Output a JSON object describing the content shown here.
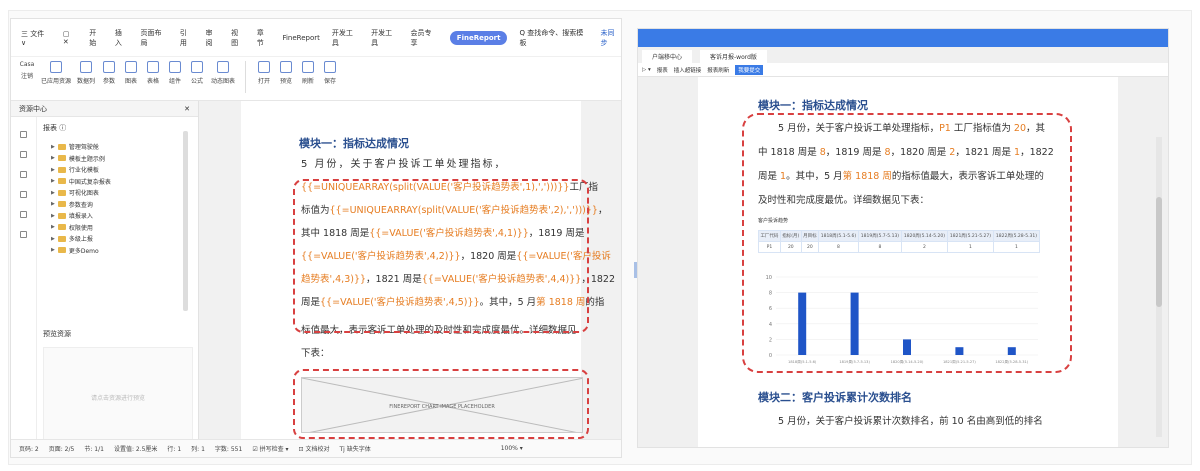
{
  "left": {
    "menu": [
      "三 文件 ∨",
      "▢ ✕",
      "开始",
      "插入",
      "页面布局",
      "引用",
      "审阅",
      "视图",
      "章节",
      "FineReport",
      "开发工具",
      "开发工具",
      "会员专享"
    ],
    "menu_pill": "FineReport",
    "menu_search": "Q 查找命令、搜索模板",
    "menu_right": "未同步",
    "ribbon": [
      "Casa",
      "注销",
      "已应用资源",
      "数据列",
      "参数",
      "图表",
      "表格",
      "组件",
      "公式",
      "动态图表",
      "打开",
      "预览",
      "刷新",
      "保存"
    ],
    "side_title": "资源中心",
    "side_close": "✕",
    "tree_header": "报表 ⓘ",
    "tree_items": [
      "管理驾驶舱",
      "模板主题示例",
      "行业化模板",
      "中国式复杂报表",
      "可视化图表",
      "参数查询",
      "填报录入",
      "权限使用",
      "多级上报",
      "更多Demo"
    ],
    "preview_title": "预览资源",
    "preview_placeholder": "请点击资源进行预览",
    "doc": {
      "heading": "模块一：指标达成情况",
      "p1": "5 月份，关于客户投诉工单处理指标，",
      "p2a": "{{=UNIQUEARRAY(split(VALUE('客户投诉趋势表',1),',')))}}",
      "p2b": "工厂指",
      "p3a": "标值为",
      "p3b": "{{=UNIQUEARRAY(split(VALUE('客户投诉趋势表',2),',')))}}",
      "p3c": "，",
      "p4a": "其中 1818 周是",
      "p4b": "{{=VALUE('客户投诉趋势表',4,1)}}",
      "p4c": "，1819 周是",
      "p5a": "{{=VALUE('客户投诉趋势表',4,2)}}",
      "p5b": "，1820 周是",
      "p5c": "{{=VALUE('客户投诉",
      "p6a": "趋势表',4,3)}}",
      "p6b": "，1821 周是",
      "p6c": "{{=VALUE('客户投诉趋势表',4,4)}}",
      "p6d": "，1822",
      "p7a": "周是",
      "p7b": "{{=VALUE('客户投诉趋势表',4,5)}}",
      "p7c": "。其中，5 月",
      "p7d": "第 1818 周",
      "p7e": "的指",
      "p8": "标值最大，表示客诉工单处理的及时性和完成度最优。详细数据见",
      "p9": "下表：",
      "img_caption": "FINEREPORT CHART IMAGE PLACEHOLDER"
    },
    "status": [
      "页码: 2",
      "页面: 2/5",
      "节: 1/1",
      "设置值: 2.5厘米",
      "行: 1",
      "列: 1",
      "字数: 551",
      "☑ 拼写检查 ▾",
      "⊡ 文档校对",
      "Tj 缺失字体",
      "100% ▾"
    ]
  },
  "right": {
    "tabs": [
      "户端移中心",
      "客诉月报-word版"
    ],
    "toolbar": [
      "▷ ▾",
      "报表",
      "插入超链接",
      "报表刷新",
      "我要提交"
    ],
    "heading": "模块一：指标达成情况",
    "l1a": "5 月份，关于客户投诉工单处理指标，",
    "l1b": "P1",
    "l1c": " 工厂指标值为 ",
    "l1d": "20",
    "l1e": "，其",
    "l2a": "中 1818 周是 ",
    "l2b": "8",
    "l2c": "，1819 周是 ",
    "l2d": "8",
    "l2e": "，1820 周是 ",
    "l2f": "2",
    "l2g": "，1821 周是 ",
    "l2h": "1",
    "l2i": "，1822",
    "l3a": "周是 ",
    "l3b": "1",
    "l3c": "。其中，5 月",
    "l3d": "第 1818 周",
    "l3e": "的指标值最大，表示客诉工单处理的",
    "l4": "及时性和完成度最优。详细数据见下表：",
    "report_title": "客户投诉趋势",
    "table_header": [
      "工厂代码",
      "指标(月)",
      "月目标",
      "1818周(5.1-5.6)",
      "1819周(5.7-5.13)",
      "1820周(5.14-5.20)",
      "1821周(5.21-5.27)",
      "1822周(5.28-5.31)"
    ],
    "table_row": [
      "P1",
      "20",
      "20",
      "8",
      "8",
      "2",
      "1",
      "1"
    ],
    "heading2": "模块二：客户投诉累计次数排名",
    "p2": "5 月份，关于客户投诉累计次数排名，前 10 名由高到低的排名"
  },
  "chart_data": {
    "type": "bar",
    "categories": [
      "1818周(5.1-5.6)",
      "1819周(5.7-5.13)",
      "1820周(5.14-5.20)",
      "1821周(5.21-5.27)",
      "1822周(5.28-5.31)"
    ],
    "values": [
      8,
      8,
      2,
      1,
      1
    ],
    "ylim": [
      0,
      10
    ],
    "yticks": [
      0,
      2,
      4,
      6,
      8,
      10
    ],
    "color": "#1f55c7"
  },
  "colors": {
    "accent": "#3a7be6",
    "highlight": "#e67d22",
    "dash": "#d84040",
    "heading": "#2a4f8f"
  }
}
